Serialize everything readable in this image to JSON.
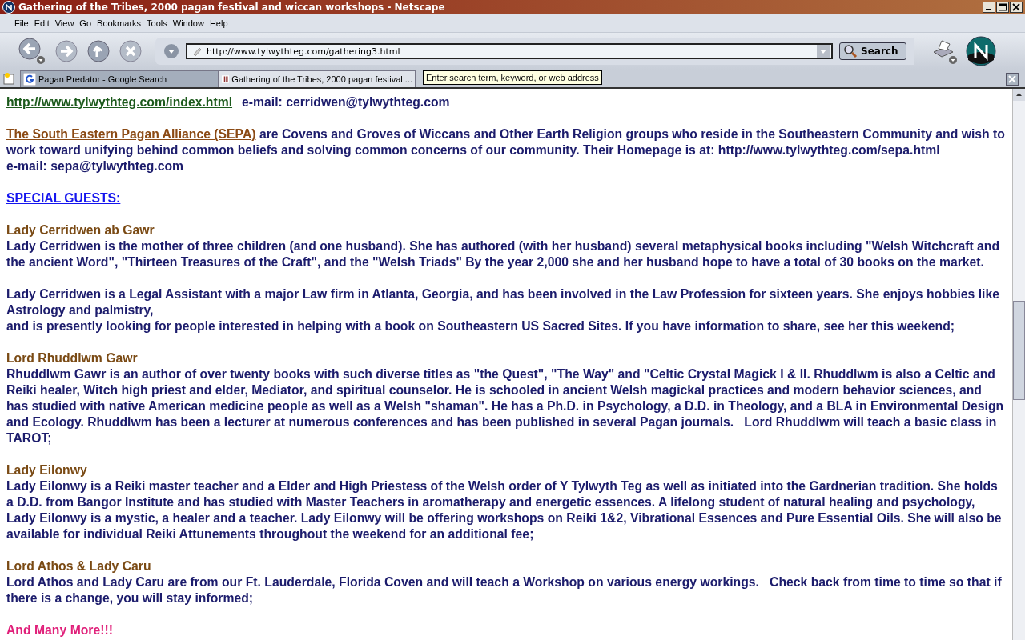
{
  "window": {
    "title": "Gathering of the Tribes, 2000 pagan festival and wiccan workshops - Netscape"
  },
  "menu": [
    "File",
    "Edit",
    "View",
    "Go",
    "Bookmarks",
    "Tools",
    "Window",
    "Help"
  ],
  "toolbar": {
    "url": "http://www.tylwythteg.com/gathering3.html",
    "search_button": "Search"
  },
  "tabs": [
    {
      "label": "Pagan Predator - Google Search",
      "selected": false
    },
    {
      "label": "Gathering of the Tribes, 2000 pagan festival ...",
      "selected": true
    }
  ],
  "tooltip": "Enter search term, keyword, or web address",
  "content": [
    {
      "kind": "contact",
      "link": "http://www.tylwythteg.com/index.html",
      "text": "e-mail: cerridwen@tylwythteg.com"
    },
    {
      "kind": "intro",
      "link": "The South Eastern Pagan Alliance (SEPA)",
      "text": " are Covens and Groves of Wiccans and Other Earth Religion groups who reside in the Southeastern Community and wish to work toward unifying behind common beliefs and solving common concerns of our community. Their Homepage is at: http://www.tylwythteg.com/sepa.html",
      "after": "e-mail: sepa@tylwythteg.com"
    },
    {
      "kind": "heading",
      "text": "SPECIAL GUESTS:"
    },
    {
      "kind": "guest",
      "name": "Lady Cerridwen ab Gawr",
      "paragraphs": [
        [
          "Lady Cerridwen is the mother of three children (and one husband). She has authored (with her husband) several metaphysical books including \"Welsh Witchcraft and the ancient Word\", \"Thirteen Treasures of the Craft\", and the \"Welsh Triads\" By the year 2,000 she and her husband hope to have a total of 30 books on the market."
        ],
        [
          "Lady Cerridwen is a Legal Assistant with a major Law firm in Atlanta, Georgia, and has been involved in the Law Profession for sixteen years. She enjoys hobbies like Astrology and palmistry,",
          "and is presently looking for people interested in helping with a book on Southeastern US Sacred Sites. If you have information to share, see her this weekend;"
        ]
      ]
    },
    {
      "kind": "guest",
      "name": "Lord Rhuddlwm Gawr",
      "paragraphs": [
        [
          "Rhuddlwm Gawr is an author of over twenty books with such diverse titles as \"the Quest\", \"The Way\" and \"Celtic Crystal Magick I & II. Rhuddlwm is also a Celtic and Reiki healer, Witch high priest and elder, Mediator, and spiritual counselor. He is schooled in ancient Welsh magickal practices and modern behavior sciences, and has studied with native American medicine people as well as a Welsh \"shaman\". He has a Ph.D. in Psychology, a D.D. in Theology, and a BLA in Environmental Design and Ecology. Rhuddlwm has been a lecturer at numerous conferences and has been published in several Pagan journals.   Lord Rhuddlwm will teach a basic class in TAROT;"
        ]
      ]
    },
    {
      "kind": "guest",
      "name": "Lady Eilonwy",
      "paragraphs": [
        [
          "Lady Eilonwy is a Reiki master teacher and a Elder and High Priestess of the Welsh order of Y Tylwyth Teg as well as initiated into the Gardnerian tradition. She holds a D.D. from Bangor Institute and has studied with Master Teachers in aromatherapy and energetic essences. A lifelong student of natural healing and psychology, Lady Eilonwy is a mystic, a healer and a teacher. Lady Eilonwy will be offering workshops on Reiki 1&2, Vibrational Essences and Pure Essential Oils. She will also be available for individual Reiki Attunements throughout the weekend for an additional fee;"
        ]
      ]
    },
    {
      "kind": "guest",
      "name": "Lord Athos & Lady Caru",
      "paragraphs": [
        [
          "Lord Athos and Lady Caru are from our Ft. Lauderdale, Florida Coven and will teach a Workshop on various energy workings.   Check back from time to time so that if there is a change, you will stay informed;"
        ]
      ]
    },
    {
      "kind": "closing",
      "text": "And Many More!!!"
    }
  ]
}
